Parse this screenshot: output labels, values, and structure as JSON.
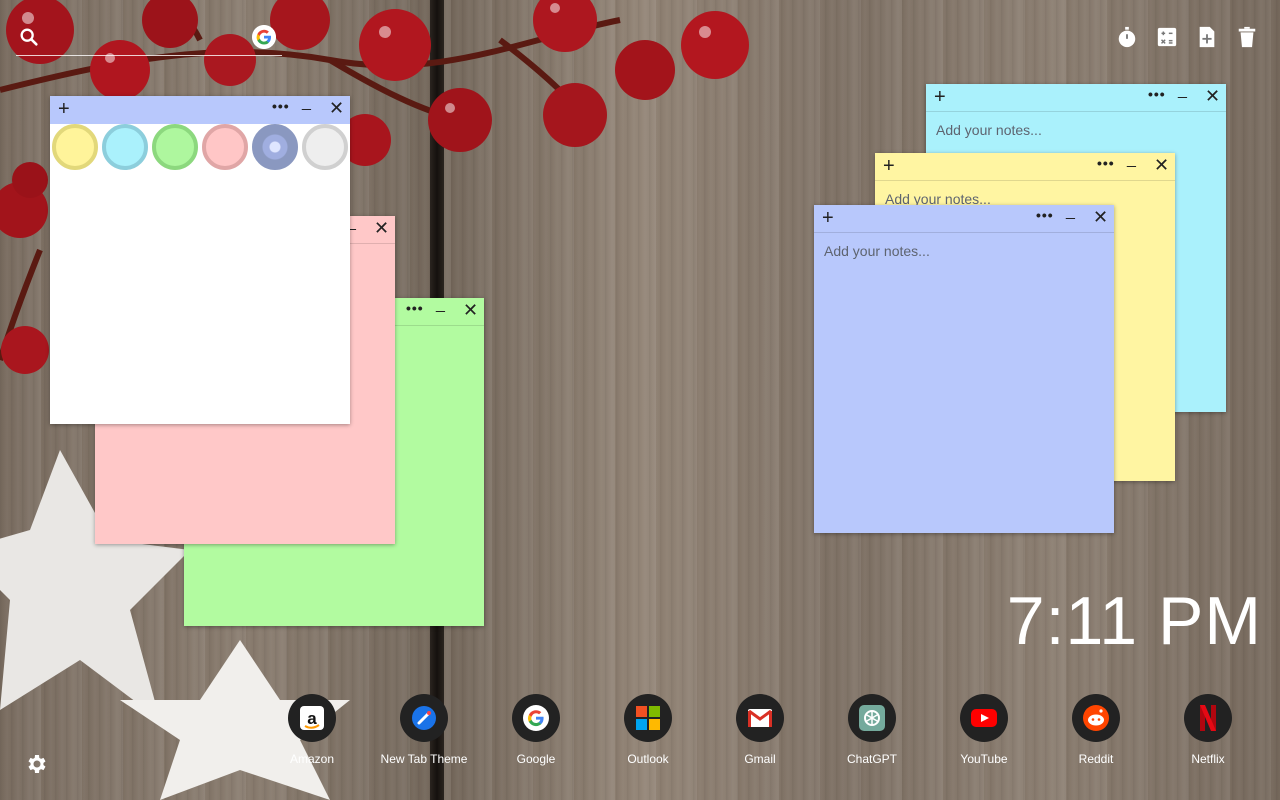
{
  "search": {
    "placeholder": "",
    "icon": "search-icon",
    "engine_icon": "google-icon"
  },
  "toolbar": {
    "icons": [
      "timer-icon",
      "calculator-icon",
      "add-note-icon",
      "trash-icon"
    ]
  },
  "notes": [
    {
      "id": "palette-note",
      "color": "#ffffff",
      "placeholder": ""
    },
    {
      "id": "pink-note",
      "color": "#ffc8c8"
    },
    {
      "id": "green-note",
      "color": "#b2fba0"
    },
    {
      "id": "cyan-note",
      "color": "#aaf1fc",
      "placeholder": "Add your notes..."
    },
    {
      "id": "yellow-note",
      "color": "#fff5a2",
      "placeholder": "Add your notes..."
    },
    {
      "id": "blue-note",
      "color": "#b8c8fc",
      "placeholder": "Add your notes..."
    }
  ],
  "note_controls": {
    "add": "+",
    "more": "•••",
    "minimize": "_",
    "close": "✕"
  },
  "palette": [
    {
      "name": "yellow",
      "fill": "#fff49a",
      "ring": "#e2d87a"
    },
    {
      "name": "cyan",
      "fill": "#aaf1fc",
      "ring": "#8ccedc"
    },
    {
      "name": "green",
      "fill": "#aef79e",
      "ring": "#8cd87e"
    },
    {
      "name": "pink",
      "fill": "#ffc6c6",
      "ring": "#e0a6a6"
    },
    {
      "name": "blue",
      "fill": "#b8c8fc",
      "ring": "#8a98c0"
    },
    {
      "name": "white",
      "fill": "#eeeeee",
      "ring": "#d0d0d0"
    }
  ],
  "clock": {
    "time": "7:11 PM"
  },
  "shortcuts": [
    {
      "label": "Amazon",
      "icon": "amazon-icon"
    },
    {
      "label": "New Tab Theme",
      "icon": "new-tab-theme-icon"
    },
    {
      "label": "Google",
      "icon": "google-icon"
    },
    {
      "label": "Outlook",
      "icon": "outlook-icon"
    },
    {
      "label": "Gmail",
      "icon": "gmail-icon"
    },
    {
      "label": "ChatGPT",
      "icon": "chatgpt-icon"
    },
    {
      "label": "YouTube",
      "icon": "youtube-icon"
    },
    {
      "label": "Reddit",
      "icon": "reddit-icon"
    },
    {
      "label": "Netflix",
      "icon": "netflix-icon"
    }
  ],
  "settings": {
    "icon": "gear-icon"
  }
}
